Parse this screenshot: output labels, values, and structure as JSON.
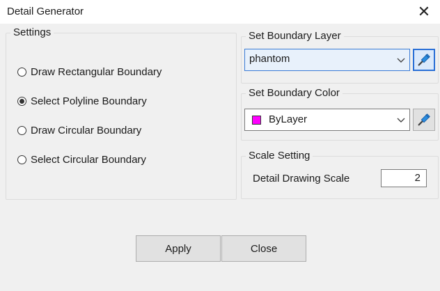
{
  "window": {
    "title": "Detail Generator",
    "close_glyph": "✕"
  },
  "settings": {
    "label": "Settings",
    "options": [
      {
        "label": "Draw Rectangular Boundary",
        "checked": false
      },
      {
        "label": "Select Polyline Boundary",
        "checked": true
      },
      {
        "label": "Draw Circular Boundary",
        "checked": false
      },
      {
        "label": "Select Circular Boundary",
        "checked": false
      }
    ]
  },
  "boundary_layer": {
    "label": "Set Boundary Layer",
    "value": "phantom",
    "pick_icon": "eyedropper-icon"
  },
  "boundary_color": {
    "label": "Set Boundary Color",
    "value": "ByLayer",
    "swatch_color": "#ff00ff",
    "pick_icon": "eyedropper-icon"
  },
  "scale": {
    "label": "Scale Setting",
    "field_label": "Detail Drawing Scale",
    "value": "2"
  },
  "buttons": {
    "apply": "Apply",
    "close": "Close"
  },
  "colors": {
    "accent": "#2a6fd6",
    "dialog_bg": "#f0f0f0"
  }
}
